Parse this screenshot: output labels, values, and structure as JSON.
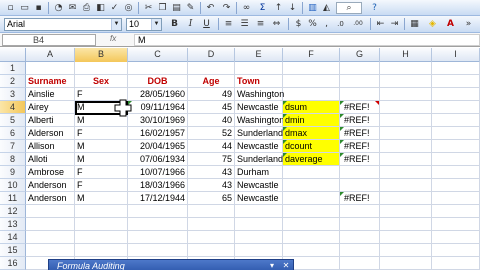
{
  "toolbar_standard": {
    "icons": [
      "new-icon",
      "open-icon",
      "save-icon",
      "permission-icon",
      "email-icon",
      "print-icon",
      "print-preview-icon",
      "spelling-icon",
      "research-icon",
      "cut-icon",
      "copy-icon",
      "paste-icon",
      "format-painter-icon",
      "undo-icon",
      "redo-icon",
      "hyperlink-icon",
      "autosum-icon",
      "sort-ascending-icon",
      "sort-descending-icon",
      "chart-wizard-icon",
      "drawing-icon",
      "zoom-icon",
      "help-icon"
    ]
  },
  "toolbar_formatting": {
    "font_name": "Arial",
    "font_size": "10",
    "bold": "B",
    "italic": "I",
    "underline": "U",
    "currency": "$",
    "percent": "%",
    "comma": ",",
    "dec_inc": ".0",
    "dec_dec": ".00"
  },
  "formula_bar": {
    "name_box": "B4",
    "fx": "fx",
    "content": "M"
  },
  "columns": [
    "A",
    "B",
    "C",
    "D",
    "E",
    "F",
    "G",
    "H",
    "I"
  ],
  "selected_column": "B",
  "selected_row": "4",
  "rows": [
    {
      "n": "1",
      "a": "",
      "b": "",
      "c": "",
      "d": "",
      "e": "",
      "f": "",
      "g": ""
    },
    {
      "n": "2",
      "a": "Surname",
      "b": "Sex",
      "c": "DOB",
      "d": "Age",
      "e": "Town",
      "f": "",
      "g": ""
    },
    {
      "n": "3",
      "a": "Ainslie",
      "b": "F",
      "c": "28/05/1960",
      "d": "49",
      "e": "Washington",
      "f": "",
      "g": ""
    },
    {
      "n": "4",
      "a": "Airey",
      "b": "M",
      "c": "09/11/1964",
      "d": "45",
      "e": "Newcastle",
      "f": "dsum",
      "g": "#REF!"
    },
    {
      "n": "5",
      "a": "Alberti",
      "b": "M",
      "c": "30/10/1969",
      "d": "40",
      "e": "Washington",
      "f": "dmin",
      "g": "#REF!"
    },
    {
      "n": "6",
      "a": "Alderson",
      "b": "F",
      "c": "16/02/1957",
      "d": "52",
      "e": "Sunderland",
      "f": "dmax",
      "g": "#REF!"
    },
    {
      "n": "7",
      "a": "Allison",
      "b": "M",
      "c": "20/04/1965",
      "d": "44",
      "e": "Newcastle",
      "f": "dcount",
      "g": "#REF!"
    },
    {
      "n": "8",
      "a": "Alloti",
      "b": "M",
      "c": "07/06/1934",
      "d": "75",
      "e": "Sunderland",
      "f": "daverage",
      "g": "#REF!"
    },
    {
      "n": "9",
      "a": "Ambrose",
      "b": "F",
      "c": "10/07/1966",
      "d": "43",
      "e": "Durham",
      "f": "",
      "g": ""
    },
    {
      "n": "10",
      "a": "Anderson",
      "b": "F",
      "c": "18/03/1966",
      "d": "43",
      "e": "Newcastle",
      "f": "",
      "g": ""
    },
    {
      "n": "11",
      "a": "Anderson",
      "b": "M",
      "c": "17/12/1944",
      "d": "65",
      "e": "Newcastle",
      "f": "",
      "g": "#REF!"
    },
    {
      "n": "12",
      "a": "",
      "b": "",
      "c": "",
      "d": "",
      "e": "",
      "f": "",
      "g": ""
    },
    {
      "n": "13",
      "a": "",
      "b": "",
      "c": "",
      "d": "",
      "e": "",
      "f": "",
      "g": ""
    },
    {
      "n": "14",
      "a": "",
      "b": "",
      "c": "",
      "d": "",
      "e": "",
      "f": "",
      "g": ""
    },
    {
      "n": "15",
      "a": "",
      "b": "",
      "c": "",
      "d": "",
      "e": "",
      "f": "",
      "g": ""
    },
    {
      "n": "16",
      "a": "",
      "b": "",
      "c": "",
      "d": "",
      "e": "",
      "f": "",
      "g": ""
    }
  ],
  "formula_auditing": {
    "title": "Formula Auditing"
  },
  "colors": {
    "header_text": "#c00000",
    "highlight": "#ffff00",
    "selection_header": "#f4c75a"
  }
}
